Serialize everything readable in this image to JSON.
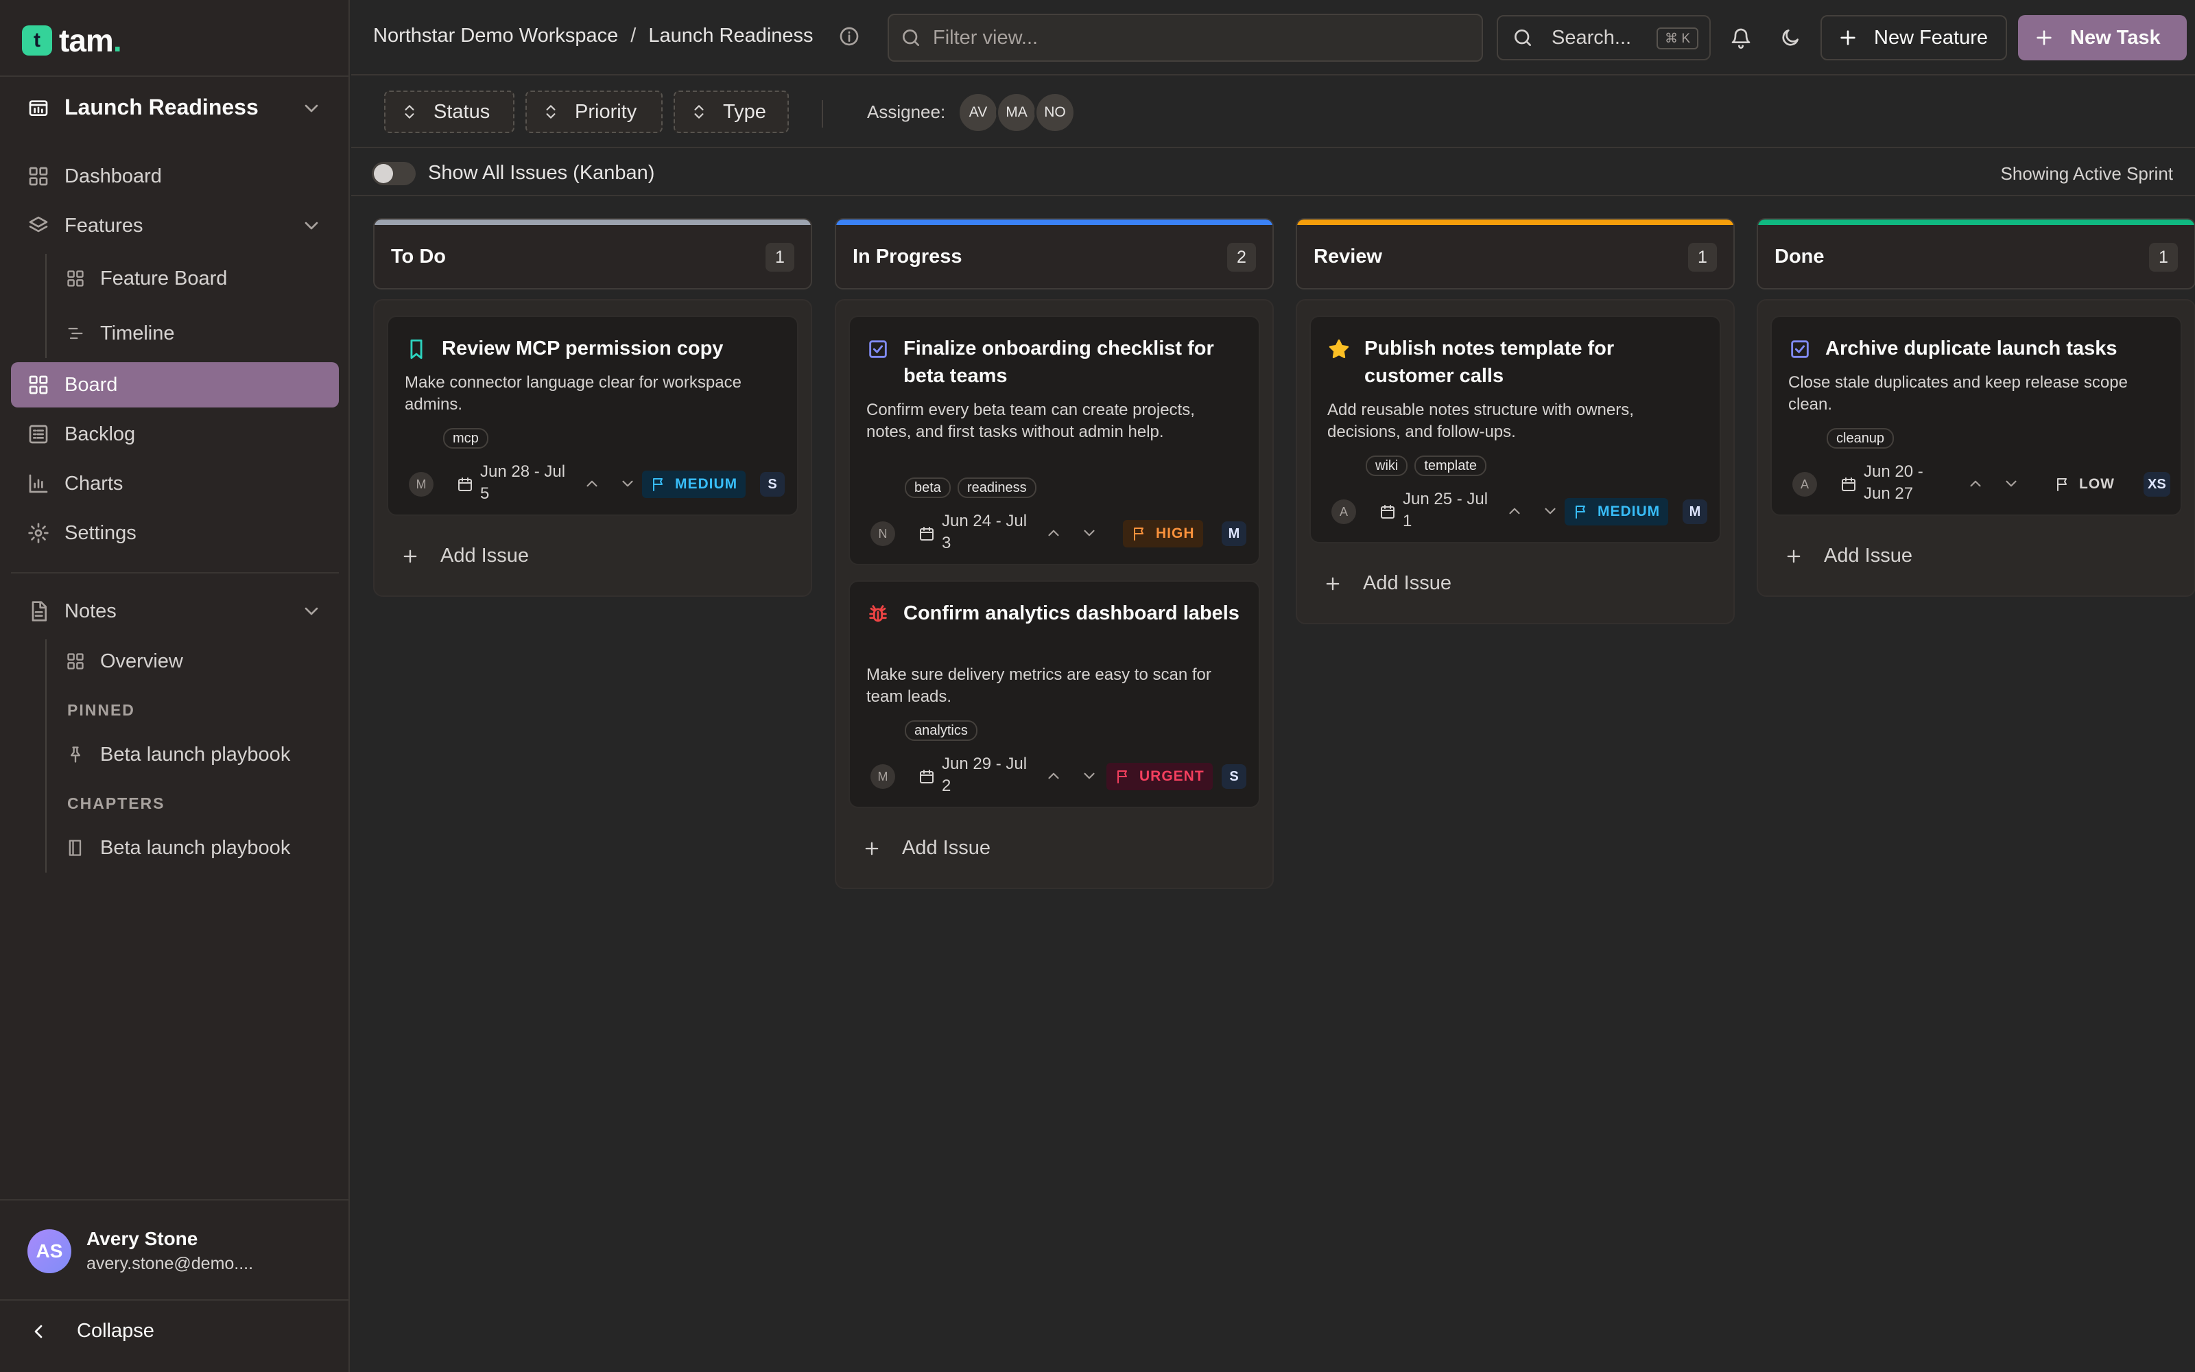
{
  "app": {
    "logo_letter": "t",
    "logo_name": "tam",
    "logo_dot": "."
  },
  "sidebar": {
    "project": "Launch Readiness",
    "nav": {
      "dashboard": "Dashboard",
      "features": "Features",
      "feature_board": "Feature Board",
      "timeline": "Timeline",
      "board": "Board",
      "backlog": "Backlog",
      "charts": "Charts",
      "settings": "Settings",
      "notes": "Notes",
      "overview": "Overview"
    },
    "pinned_label": "PINNED",
    "pinned_item": "Beta launch playbook",
    "chapters_label": "CHAPTERS",
    "chapter_item": "Beta launch playbook",
    "user": {
      "initials": "AS",
      "name": "Avery Stone",
      "email": "avery.stone@demo...."
    },
    "collapse_label": "Collapse"
  },
  "header": {
    "breadcrumb": [
      "Northstar Demo Workspace",
      "Launch Readiness"
    ],
    "breadcrumb_sep": "/",
    "filter_placeholder": "Filter view...",
    "search_label": "Search...",
    "search_shortcut": "⌘ K",
    "new_feature": "New Feature",
    "new_task": "New Task"
  },
  "filters": {
    "status": "Status",
    "priority": "Priority",
    "type": "Type",
    "assignee_label": "Assignee:",
    "assignees": [
      "AV",
      "MA",
      "NO"
    ]
  },
  "toggle": {
    "label": "Show All Issues (Kanban)",
    "on": false
  },
  "sprint_label": "Showing Active Sprint",
  "add_issue_label": "Add Issue",
  "columns": [
    {
      "title": "To Do",
      "count": "1",
      "color": "#9ca3af",
      "cards": [
        {
          "type_icon": "bookmark-icon",
          "title": "Review MCP permission copy",
          "description": "Make connector language clear for workspace admins.",
          "tags": [
            "mcp"
          ],
          "assignee": "M",
          "date": "Jun 28 - Jul 5",
          "priority": "MEDIUM",
          "size": "S"
        }
      ]
    },
    {
      "title": "In Progress",
      "count": "2",
      "color": "#3b82f6",
      "cards": [
        {
          "type_icon": "task-check-icon",
          "title": "Finalize onboarding checklist for beta teams",
          "description": "Confirm every beta team can create projects, notes, and first tasks without admin help.",
          "tags": [
            "beta",
            "readiness"
          ],
          "assignee": "N",
          "date": "Jun 24 - Jul 3",
          "priority": "HIGH",
          "size": "M"
        },
        {
          "type_icon": "bug-icon",
          "title": "Confirm analytics dashboard labels",
          "description": "Make sure delivery metrics are easy to scan for team leads.",
          "tags": [
            "analytics"
          ],
          "assignee": "M",
          "date": "Jun 29 - Jul 2",
          "priority": "URGENT",
          "size": "S"
        }
      ]
    },
    {
      "title": "Review",
      "count": "1",
      "color": "#f59e0b",
      "cards": [
        {
          "type_icon": "star-icon",
          "title": "Publish notes template for customer calls",
          "description": "Add reusable notes structure with owners, decisions, and follow-ups.",
          "tags": [
            "wiki",
            "template"
          ],
          "assignee": "A",
          "date": "Jun 25 - Jul 1",
          "priority": "MEDIUM",
          "size": "M"
        }
      ]
    },
    {
      "title": "Done",
      "count": "1",
      "color": "#10b981",
      "cards": [
        {
          "type_icon": "task-check-icon",
          "title": "Archive duplicate launch tasks",
          "description": "Close stale duplicates and keep release scope clean.",
          "tags": [
            "cleanup"
          ],
          "assignee": "A",
          "date": "Jun 20 - Jun 27",
          "priority": "LOW",
          "size": "XS"
        }
      ]
    }
  ],
  "priority_colors": {
    "LOW": "#d6d3d1",
    "MEDIUM": "#38bdf8",
    "HIGH": "#fb923c",
    "URGENT": "#f43f5e"
  }
}
